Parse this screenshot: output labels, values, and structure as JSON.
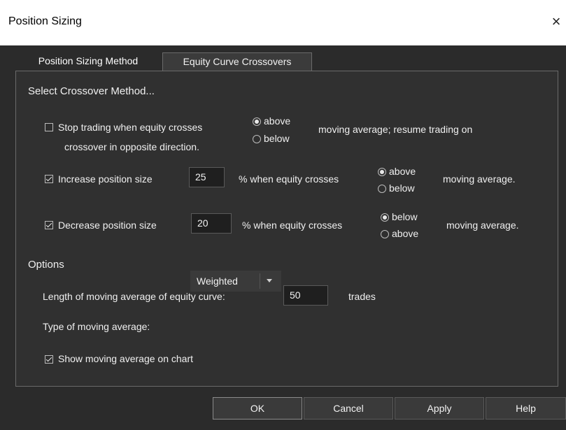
{
  "window": {
    "title": "Position Sizing",
    "close_glyph": "×"
  },
  "tabs": [
    {
      "label": "Position Sizing Method",
      "active": false
    },
    {
      "label": "Equity Curve Crossovers",
      "active": true
    }
  ],
  "section_crossover": {
    "heading": "Select Crossover Method...",
    "stop_trading": {
      "checked": false,
      "label_line1": "Stop trading when equity crosses",
      "label_line2": "crossover in opposite direction.",
      "radio_above": "above",
      "radio_below": "below",
      "selected": "above",
      "suffix": "moving average; resume trading on"
    },
    "increase": {
      "checked": true,
      "label": "Increase position size",
      "value": "25",
      "mid_text": "% when equity crosses",
      "radio_first": "above",
      "radio_second": "below",
      "selected": "above",
      "suffix": "moving average."
    },
    "decrease": {
      "checked": true,
      "label": "Decrease position size",
      "value": "20",
      "mid_text": "% when equity crosses",
      "radio_first": "below",
      "radio_second": "above",
      "selected": "below",
      "suffix": "moving average."
    }
  },
  "section_options": {
    "heading": "Options",
    "length_label": "Length of moving average of equity curve:",
    "length_value": "50",
    "length_unit": "trades",
    "type_label": "Type of moving average:",
    "type_value": "Weighted",
    "show_on_chart": {
      "checked": true,
      "label": "Show moving average on chart"
    }
  },
  "buttons": {
    "ok": "OK",
    "cancel": "Cancel",
    "apply": "Apply",
    "help": "Help"
  },
  "colors": {
    "dialog_bg": "#2b2b2b",
    "panel_bg": "#303030",
    "text": "#f0f0f0",
    "titlebar_bg": "#ffffff"
  }
}
